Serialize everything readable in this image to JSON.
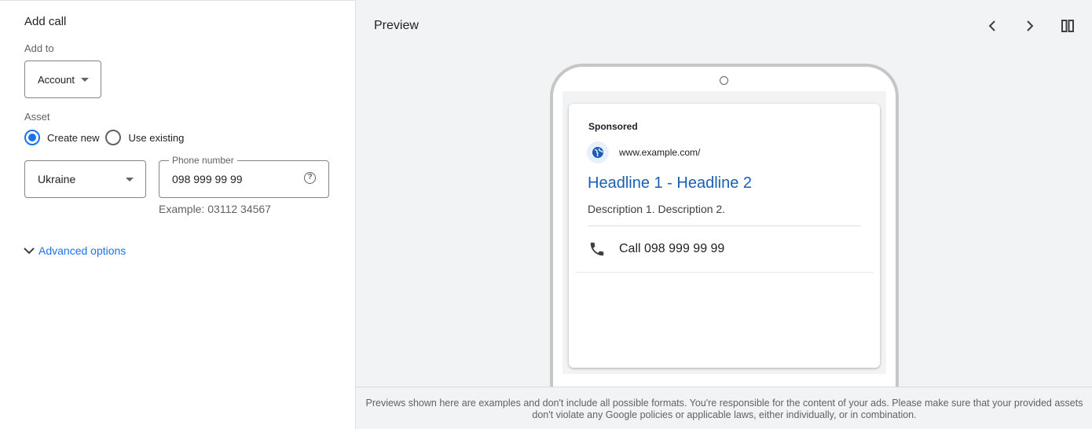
{
  "form": {
    "title": "Add call",
    "add_to_label": "Add to",
    "add_to_value": "Account",
    "asset_label": "Asset",
    "radio_create": "Create new",
    "radio_existing": "Use existing",
    "country_value": "Ukraine",
    "phone_label": "Phone number",
    "phone_value": "098 999 99 99",
    "help_glyph": "?",
    "example": "Example: 03112 34567",
    "advanced": "Advanced options"
  },
  "preview": {
    "title": "Preview",
    "ad": {
      "sponsored": "Sponsored",
      "url": "www.example.com/",
      "headline": "Headline 1 - Headline 2",
      "description": "Description 1. Description 2.",
      "call": "Call 098 999 99 99"
    },
    "footer": "Previews shown here are examples and don't include all possible formats. You're responsible for the content of your ads. Please make sure that your provided assets don't violate any Google policies or applicable laws, either individually, or in combination."
  },
  "colors": {
    "accent": "#1a73e8",
    "headline": "#1a5fb4",
    "panel_bg": "#f1f3f4"
  },
  "icons": [
    "chevron-left-icon",
    "chevron-right-icon",
    "columns-icon",
    "globe-icon",
    "phone-icon",
    "help-icon",
    "chevron-down-icon",
    "caret-down-icon"
  ]
}
